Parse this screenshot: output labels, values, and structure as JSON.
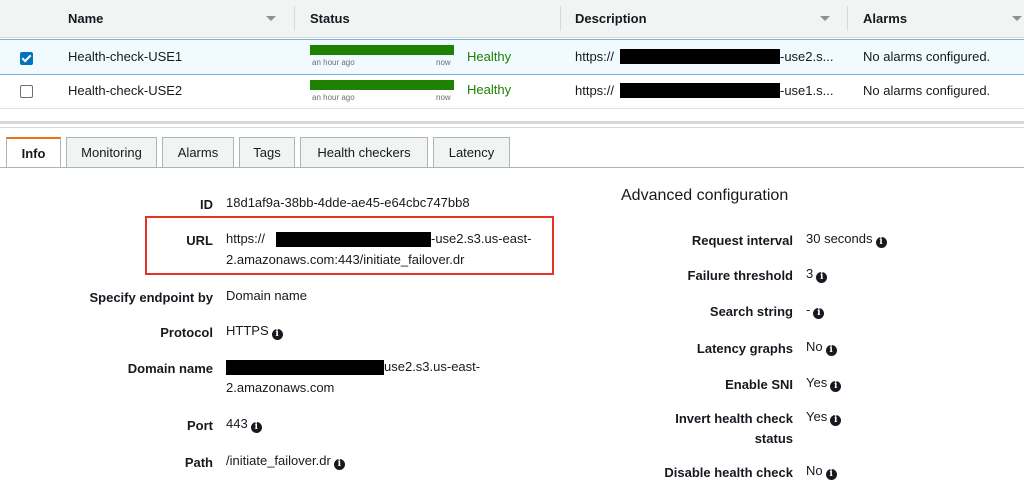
{
  "table": {
    "headers": [
      "Name",
      "Status",
      "Description",
      "Alarms"
    ],
    "rows": [
      {
        "name": "Health-check-USE1",
        "selected": true,
        "bar_start": "an hour ago",
        "bar_end": "now",
        "status": "Healthy",
        "desc_prefix": "https://",
        "desc_suffix": "-use2.s...",
        "alarms": "No alarms configured."
      },
      {
        "name": "Health-check-USE2",
        "selected": false,
        "bar_start": "an hour ago",
        "bar_end": "now",
        "status": "Healthy",
        "desc_prefix": "https://",
        "desc_suffix": "-use1.s...",
        "alarms": "No alarms configured."
      }
    ]
  },
  "tabs": [
    "Info",
    "Monitoring",
    "Alarms",
    "Tags",
    "Health checkers",
    "Latency"
  ],
  "details": {
    "id_label": "ID",
    "id_value": "18d1af9a-38bb-4dde-ae45-e64cbc747bb8",
    "url_label": "URL",
    "url_prefix": "https://",
    "url_suffix": "-use2.s3.us-east-",
    "url_line2": "2.amazonaws.com:443/initiate_failover.dr",
    "endpoint_label": "Specify endpoint by",
    "endpoint_value": "Domain name",
    "protocol_label": "Protocol",
    "protocol_value": "HTTPS",
    "domain_label": "Domain name",
    "domain_suffix": "use2.s3.us-east-",
    "domain_line2": "2.amazonaws.com",
    "port_label": "Port",
    "port_value": "443",
    "path_label": "Path",
    "path_value": "/initiate_failover.dr"
  },
  "advanced": {
    "title": "Advanced configuration",
    "request_interval_label": "Request interval",
    "request_interval_value": "30 seconds",
    "failure_threshold_label": "Failure threshold",
    "failure_threshold_value": "3",
    "search_string_label": "Search string",
    "search_string_value": "-",
    "latency_graphs_label": "Latency graphs",
    "latency_graphs_value": "No",
    "enable_sni_label": "Enable SNI",
    "enable_sni_value": "Yes",
    "invert_label_1": "Invert health check",
    "invert_label_2": "status",
    "invert_value": "Yes",
    "disable_label": "Disable health check",
    "disable_value": "No"
  },
  "colors": {
    "healthy": "#1d8102",
    "accent": "#ec7211",
    "selected_row": "#f1faff",
    "highlight": "#e4342a"
  }
}
